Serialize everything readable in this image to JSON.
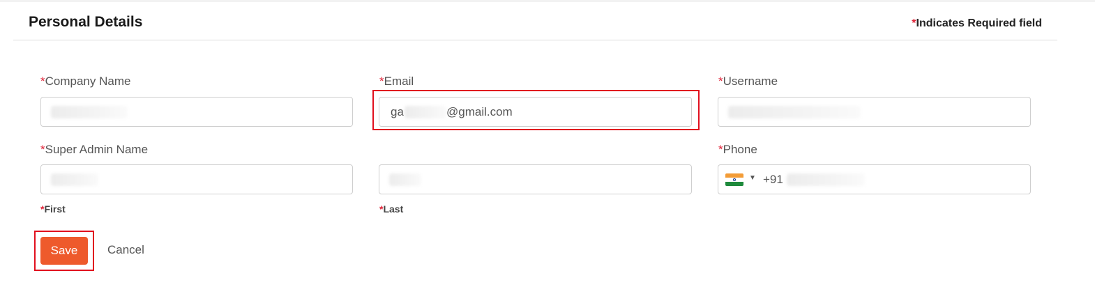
{
  "header": {
    "title": "Personal Details",
    "required_star": "*",
    "required_note": "Indicates Required field"
  },
  "fields": {
    "company_name": {
      "star": "*",
      "label": "Company Name",
      "value": ""
    },
    "email": {
      "star": "*",
      "label": "Email",
      "value_prefix": "ga",
      "value_suffix": "@gmail.com"
    },
    "username": {
      "star": "*",
      "label": "Username",
      "value": ""
    },
    "super_admin_name": {
      "star": "*",
      "label": "Super Admin Name",
      "first_sublabel": "First",
      "last_sublabel": "Last"
    },
    "phone": {
      "star": "*",
      "label": "Phone",
      "country": "India",
      "dial_code": "+91"
    }
  },
  "actions": {
    "save_label": "Save",
    "cancel_label": "Cancel"
  },
  "colors": {
    "accent": "#ee5a2c",
    "required": "#e0263a",
    "highlight": "#e10f1e"
  }
}
